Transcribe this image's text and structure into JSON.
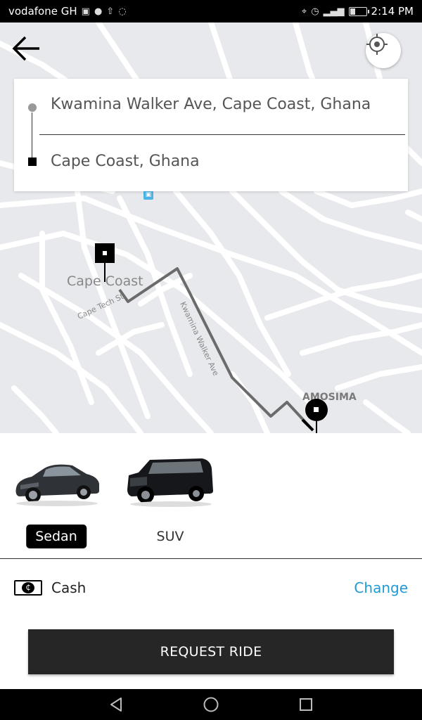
{
  "status_bar": {
    "carrier": "vodafone GH",
    "time": "2:14 PM",
    "left_icons": [
      "gallery-icon",
      "chat-icon",
      "upload-icon",
      "whatsapp-icon"
    ],
    "right_icons": [
      "location-icon",
      "alarm-icon",
      "signal-icon",
      "battery-icon"
    ],
    "battery_level": 0.3
  },
  "map": {
    "labels": {
      "area_main": "Cape Coast",
      "street_tech": "Cape Tech St",
      "street_kwamina": "Kwamina Walker Ave",
      "area_amosima": "AMOSIMA"
    }
  },
  "route": {
    "pickup": "Kwamina Walker Ave, Cape Coast, Ghana",
    "destination": "Cape Coast, Ghana"
  },
  "vehicles": [
    {
      "label": "Sedan",
      "selected": true
    },
    {
      "label": "SUV",
      "selected": false
    }
  ],
  "payment": {
    "method": "Cash",
    "change_label": "Change"
  },
  "request_button": "REQUEST RIDE",
  "colors": {
    "accent_link": "#1f9bd7",
    "map_background": "#e8e9ec",
    "button_dark": "#262626"
  }
}
